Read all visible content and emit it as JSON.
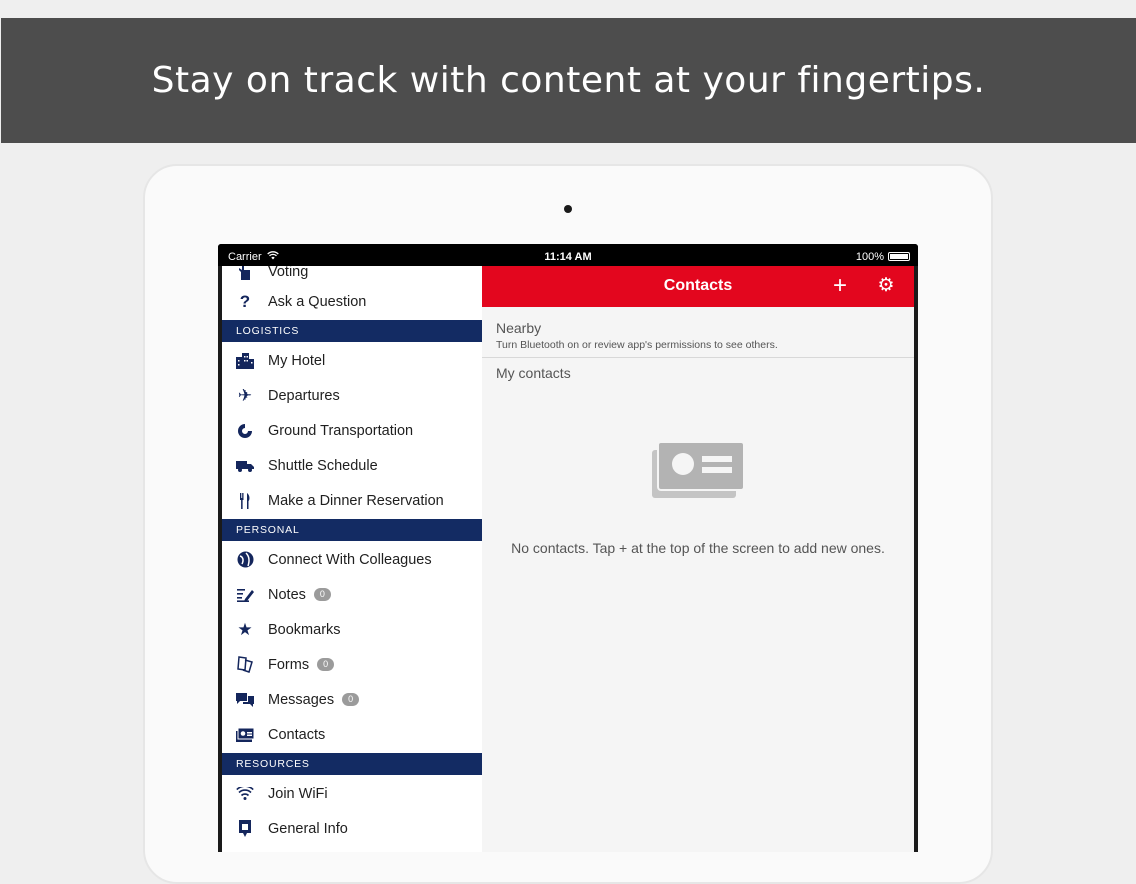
{
  "banner": {
    "text": "Stay on track with content at your fingertips."
  },
  "statusbar": {
    "carrier": "Carrier",
    "time": "11:14 AM",
    "battery": "100%"
  },
  "sidebar": {
    "top_items": [
      {
        "label": "Voting",
        "icon": "hand-icon"
      },
      {
        "label": "Ask a Question",
        "icon": "question-icon"
      }
    ],
    "sections": {
      "logistics": "LOGISTICS",
      "personal": "PERSONAL",
      "resources": "RESOURCES"
    },
    "logistics_items": [
      {
        "label": "My Hotel",
        "icon": "hotel-icon"
      },
      {
        "label": "Departures",
        "icon": "airplane-icon"
      },
      {
        "label": "Ground Transportation",
        "icon": "transport-icon"
      },
      {
        "label": "Shuttle Schedule",
        "icon": "truck-icon"
      },
      {
        "label": "Make a Dinner Reservation",
        "icon": "fork-knife-icon"
      }
    ],
    "personal_items": [
      {
        "label": "Connect With Colleagues",
        "icon": "globe-icon"
      },
      {
        "label": "Notes",
        "icon": "notes-icon",
        "badge": "0"
      },
      {
        "label": "Bookmarks",
        "icon": "star-icon"
      },
      {
        "label": "Forms",
        "icon": "forms-icon",
        "badge": "0"
      },
      {
        "label": "Messages",
        "icon": "chat-icon",
        "badge": "0"
      },
      {
        "label": "Contacts",
        "icon": "contact-card-icon"
      }
    ],
    "resources_items": [
      {
        "label": "Join WiFi",
        "icon": "wifi-icon"
      },
      {
        "label": "General Info",
        "icon": "info-icon"
      }
    ]
  },
  "main": {
    "title": "Contacts",
    "add_label": "+",
    "nearby_title": "Nearby",
    "nearby_sub": "Turn Bluetooth on or review app's permissions to see others.",
    "mycontacts_title": "My contacts",
    "empty_text": "No contacts. Tap + at the top of the screen to add new ones."
  },
  "colors": {
    "accent": "#e3061e",
    "section": "#132b63",
    "banner": "#4d4d4d"
  }
}
